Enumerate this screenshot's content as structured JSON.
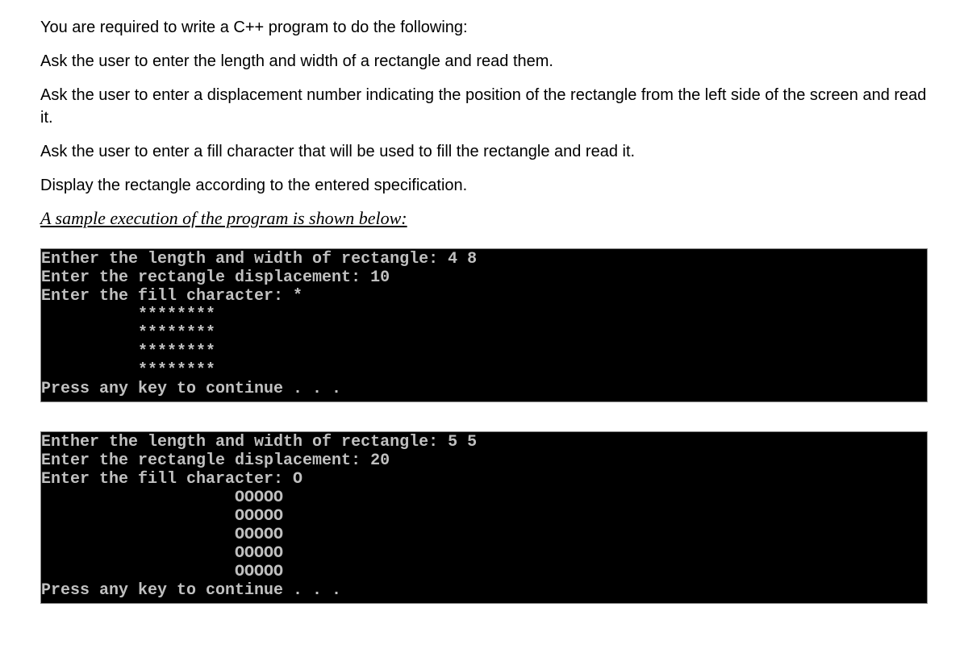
{
  "instructions": {
    "p1": "You are required to write a C++ program to do the following:",
    "p2": "Ask the user to enter the length and width of a rectangle and read them.",
    "p3": "Ask the user to enter a displacement number indicating the position of the rectangle from the left side of the screen and read it.",
    "p4": "Ask the user to enter a fill character that will be used to fill the rectangle and read it.",
    "p5": "Display the rectangle according to the entered specification."
  },
  "sample_heading": "A sample execution of the program is shown below:",
  "console1": "Enther the length and width of rectangle: 4 8\nEnter the rectangle displacement: 10\nEnter the fill character: *\n          ********\n          ********\n          ********\n          ********\nPress any key to continue . . .",
  "console2": "Enther the length and width of rectangle: 5 5\nEnter the rectangle displacement: 20\nEnter the fill character: O\n                    OOOOO\n                    OOOOO\n                    OOOOO\n                    OOOOO\n                    OOOOO\nPress any key to continue . . ."
}
